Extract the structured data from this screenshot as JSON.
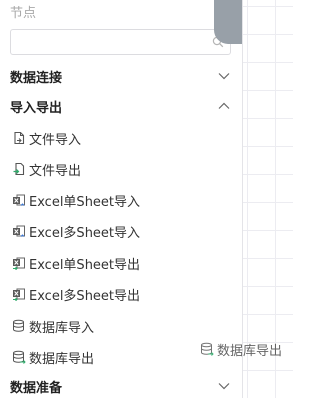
{
  "panel": {
    "node_heading": "节点",
    "search": {
      "value": "",
      "placeholder": ""
    },
    "groups": [
      {
        "label": "数据连接",
        "state": "collapsed"
      },
      {
        "label": "导入导出",
        "state": "expanded"
      },
      {
        "label": "数据准备",
        "state": "collapsed"
      }
    ],
    "import_export_items": [
      {
        "label": "文件导入",
        "icon": "file-import-icon"
      },
      {
        "label": "文件导出",
        "icon": "file-export-icon"
      },
      {
        "label": "Excel单Sheet导入",
        "icon": "excel-import-icon"
      },
      {
        "label": "Excel多Sheet导入",
        "icon": "excel-import-icon"
      },
      {
        "label": "Excel单Sheet导出",
        "icon": "excel-export-icon"
      },
      {
        "label": "Excel多Sheet导出",
        "icon": "excel-export-icon"
      },
      {
        "label": "数据库导入",
        "icon": "database-import-icon"
      },
      {
        "label": "数据库导出",
        "icon": "database-export-icon"
      }
    ]
  },
  "drag_ghost": {
    "label": "数据库导出",
    "icon": "database-export-icon"
  },
  "colors": {
    "accent_green": "#2eaa6a",
    "accent_blue": "#3a78d8",
    "icon_gray": "#666666"
  }
}
